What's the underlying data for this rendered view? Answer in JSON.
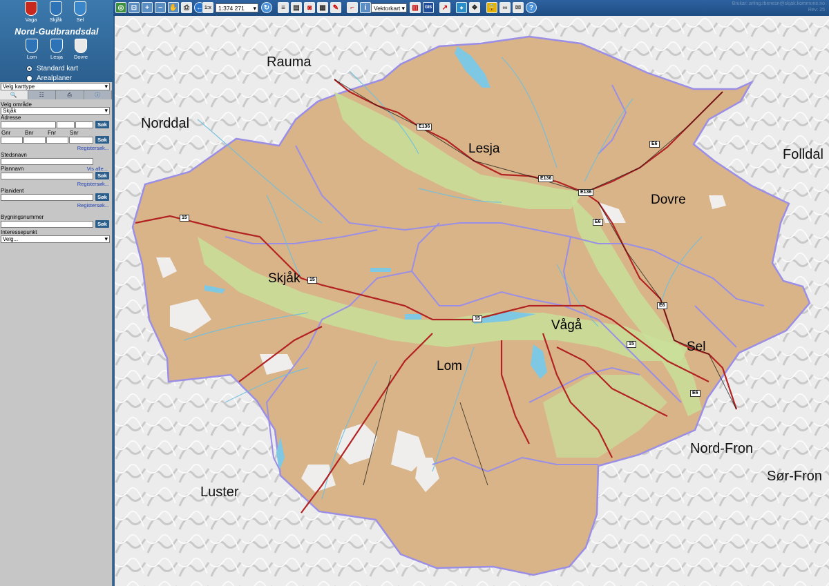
{
  "sidebar": {
    "crests": [
      {
        "name": "Vaga",
        "color": "#c8281e"
      },
      {
        "name": "Skjåk",
        "color": "#2f73b7"
      },
      {
        "name": "Sel",
        "color": "#3a86c8"
      },
      {
        "name": "Lom",
        "color": "#2f73b7"
      },
      {
        "name": "Lesja",
        "color": "#2f73b7"
      },
      {
        "name": "Dovre",
        "color": "#e9e9e9"
      }
    ],
    "title": "Nord-Gudbrandsdal",
    "map_modes": [
      "Standard kart",
      "Arealplaner"
    ],
    "map_type_select": "Velg karttype",
    "form": {
      "area_label": "Velg område",
      "area_value": "Skjåk",
      "address_label": "Adresse",
      "search": "Søk",
      "gnr": "Gnr",
      "bnr": "Bnr",
      "fnr": "Fnr",
      "snr": "Snr",
      "register_search": "Registersøk...",
      "place_label": "Stedsnavn",
      "plan_label": "Plannavn",
      "show_all": "Vis alle...",
      "plan_id_label": "Planident",
      "building_label": "Bygningsnummer",
      "poi_label": "Interessepunkt",
      "poi_value": "Velg..."
    }
  },
  "toolbar": {
    "scale": "1:374 271",
    "map_type": "Vektorkart",
    "user_line1": "Brukar: arling.rbenesn@skjak.kommune.no",
    "user_line2": "Rev: 25"
  },
  "map": {
    "municipalities": [
      {
        "name": "Lesja"
      },
      {
        "name": "Dovre"
      },
      {
        "name": "Skjåk"
      },
      {
        "name": "Vågå"
      },
      {
        "name": "Sel"
      },
      {
        "name": "Lom"
      }
    ],
    "neighbours": [
      "Rauma",
      "Norddal",
      "Folldal",
      "Nord-Fron",
      "Sør-Fron",
      "Luster"
    ],
    "road_labels": [
      "E136",
      "E136",
      "E136",
      "E6",
      "E6",
      "E6",
      "E6",
      "15",
      "15",
      "15",
      "15"
    ]
  },
  "colors": {
    "terrain": "#d8b488",
    "valley": "#c9df9a",
    "boundary": "#9a8ee6",
    "road": "#b22222",
    "water": "#7ec8e3"
  }
}
